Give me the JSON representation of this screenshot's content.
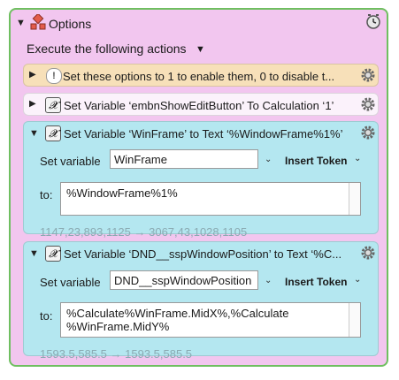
{
  "group": {
    "title": "Options",
    "execute_label": "Execute the following actions"
  },
  "actions": [
    {
      "title": "Set these options to 1 to enable them, 0 to disable t..."
    },
    {
      "title": "Set Variable ‘embnShowEditButton’ To Calculation ‘1’"
    },
    {
      "title": "Set Variable ‘WinFrame’ to Text ‘%WindowFrame%1%’",
      "set_variable_label": "Set variable",
      "variable_value": "WinFrame",
      "insert_token_label": "Insert Token",
      "to_label": "to:",
      "text_value": "%WindowFrame%1%",
      "result": "1147,23,893,1125 → 3067,43,1028,1105"
    },
    {
      "title": "Set Variable ‘DND__sspWindowPosition’ to Text ‘%C...",
      "set_variable_label": "Set variable",
      "variable_value": "DND__sspWindowPosition",
      "insert_token_label": "Insert Token",
      "to_label": "to:",
      "text_line1": "%Calculate%WinFrame.MidX%,%Calculate",
      "text_line2": "%WinFrame.MidY%",
      "result": "1593.5,585.5 → 1593.5,585.5"
    }
  ]
}
